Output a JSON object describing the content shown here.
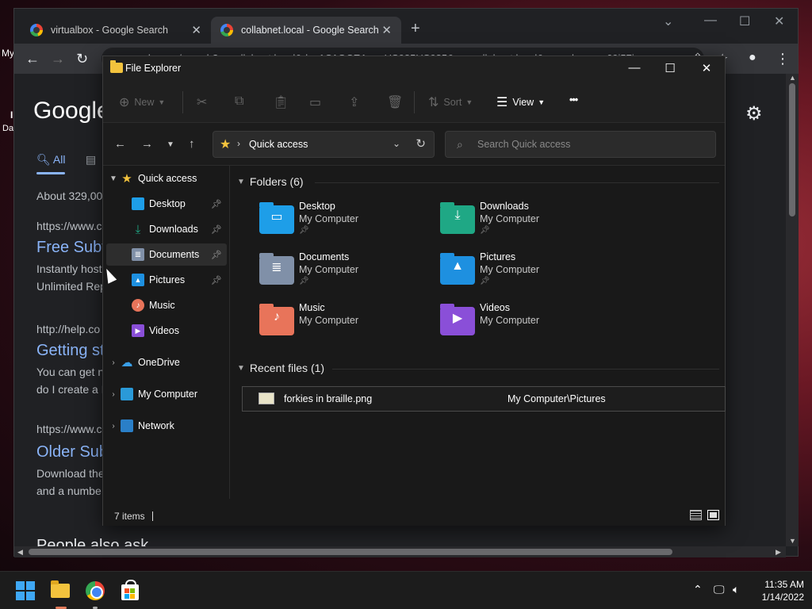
{
  "desktop": {
    "peek_left_1": "My",
    "peek_left_2": "I",
    "peek_left_3": "Da"
  },
  "chrome": {
    "tabs": [
      {
        "title": "virtualbox - Google Search",
        "active": false
      },
      {
        "title": "collabnet.local - Google Search",
        "active": true
      }
    ],
    "new_tab": "+",
    "minimize": "⌄",
    "url": "google.com/search?q=collabnet.local&rlz=1C1GCEA_enUS985US985&oq=collabnet.local&aqs=chrome..69i57j",
    "page": {
      "logo": "Google",
      "tab_all": "All",
      "result_count": "About 329,00",
      "results": [
        {
          "url": "https://www.c",
          "title": "Free Subv",
          "snippet1": "Instantly host",
          "snippet2": "Unlimited Rep"
        },
        {
          "url": "http://help.co",
          "title": "Getting st",
          "snippet1": "You can get n",
          "snippet2": "do I create a P"
        },
        {
          "url": "https://www.c",
          "title": "Older Sub",
          "snippet1": "Download the",
          "snippet2": "and a numbe"
        }
      ],
      "people_also_ask": "People also ask"
    }
  },
  "explorer": {
    "title": "File Explorer",
    "commands": {
      "new": "New",
      "sort": "Sort",
      "view": "View",
      "more": "•••"
    },
    "address": {
      "path": "Quick access",
      "search_placeholder": "Search Quick access"
    },
    "nav": {
      "quick_access": "Quick access",
      "pinned": [
        {
          "label": "Desktop",
          "pinned": true,
          "icon": "desktop-icon"
        },
        {
          "label": "Downloads",
          "pinned": true,
          "icon": "download-icon"
        },
        {
          "label": "Documents",
          "pinned": true,
          "icon": "document-icon"
        },
        {
          "label": "Pictures",
          "pinned": true,
          "icon": "picture-icon"
        },
        {
          "label": "Music",
          "pinned": false,
          "icon": "music-icon"
        },
        {
          "label": "Videos",
          "pinned": false,
          "icon": "video-icon"
        }
      ],
      "onedrive": "OneDrive",
      "my_computer": "My Computer",
      "network": "Network"
    },
    "folders_header": "Folders (6)",
    "folders": [
      {
        "name": "Desktop",
        "location": "My Computer",
        "pinned": true,
        "color": "#1e9ee8",
        "glyph": "▭"
      },
      {
        "name": "Downloads",
        "location": "My Computer",
        "pinned": true,
        "color": "#1fa885",
        "glyph": "⤓"
      },
      {
        "name": "Documents",
        "location": "My Computer",
        "pinned": true,
        "color": "#8090a8",
        "glyph": "≣"
      },
      {
        "name": "Pictures",
        "location": "My Computer",
        "pinned": true,
        "color": "#1e90e0",
        "glyph": "▲"
      },
      {
        "name": "Music",
        "location": "My Computer",
        "pinned": false,
        "color": "#e8745a",
        "glyph": "♪"
      },
      {
        "name": "Videos",
        "location": "My Computer",
        "pinned": false,
        "color": "#8a4fd8",
        "glyph": "▶"
      }
    ],
    "recent_header": "Recent files (1)",
    "recent_files": [
      {
        "name": "forkies in braille.png",
        "location": "My Computer\\Pictures"
      }
    ],
    "status": {
      "item_count": "7 items"
    }
  },
  "taskbar": {
    "time": "11:35 AM",
    "date": "1/14/2022"
  }
}
